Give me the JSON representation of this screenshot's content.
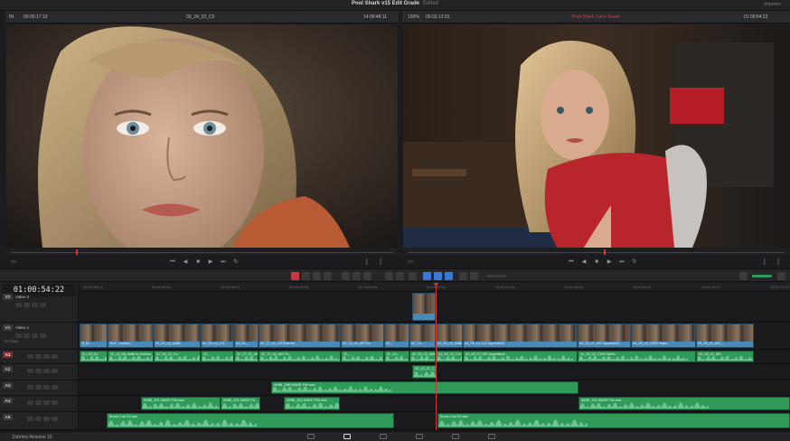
{
  "title_bar": {
    "project": "Pool Shark v15 Edit Grade",
    "status": "Edited",
    "right_label": "Importer"
  },
  "viewer_left": {
    "in_label": "IN",
    "source_tc": "00:00:17:13",
    "clip_name": "03_24_02_C0",
    "clip_tc": "14:09:48:11"
  },
  "viewer_right": {
    "zoom": "126%",
    "duration": "00:02:13:01",
    "timeline_name": "Pool Shark Color Grade",
    "record_tc": "01:00:54:22"
  },
  "scrub": {
    "left_position": 0.17,
    "right_position": 0.52
  },
  "timeline": {
    "timecode": "01:00:54:22",
    "ruler": [
      "01:00:35:13",
      "01:00:40:15",
      "01:00:45:14",
      "01:00:49:16",
      "01:00:53:16",
      "01:00:57:14",
      "01:01:01:16",
      "01:01:05:14",
      "01:01:09:11",
      "01:01:13:07",
      "01:01:17:15"
    ],
    "tracks": [
      {
        "tag": "V2",
        "name": "Video 2",
        "clips": ""
      },
      {
        "tag": "V1",
        "name": "Video 1",
        "clips": "16 Clips"
      },
      {
        "tag": "A1",
        "name": "",
        "clips": ""
      },
      {
        "tag": "A2",
        "name": "",
        "clips": ""
      },
      {
        "tag": "A3",
        "name": "",
        "clips": ""
      },
      {
        "tag": "A4",
        "name": "",
        "clips": ""
      },
      {
        "tag": "A5",
        "name": "",
        "clips": ""
      }
    ],
    "v1_clips": [
      "Ti_M..",
      "Text - Custom",
      "02_24_04_Walk..",
      "02_25_10_C4..",
      "02_24_..",
      "02_27_01_SS Exterior",
      "02_12_31_MS Fo..",
      "02_..",
      "02_14..",
      "02_26_10_Walk to Exterior",
      "04_09_10_CU Upperdeck",
      "04_22_07_MS Upperdeck",
      "04_08_02_CWS Stairs",
      "05_08_01_MS_.."
    ],
    "a1_clips": [
      "01_08_01..",
      "02_24_08_Walk to Exterior",
      "02_25_10_Cu..",
      "02_..",
      "02_27_01_MS Exterior",
      "02_12_31_MS Fo..",
      "02_..",
      "02_14..",
      "02_26_10_Walk to Exterior",
      "04_09_10_CU Upperdeck",
      "04_20_07_MS Upperdeck",
      "04_08_02_CWS Stairs",
      "05_08_01_MS.."
    ],
    "a2_clips": [
      "02_20_01_C.."
    ],
    "a3_clips": [
      "AMBI_2BR-WAVE File.wav"
    ],
    "a4_clips": [
      "AMBI_321-WAVE File.wav",
      "AMBI_321-WAVE Fil..",
      "AMBI_321-WAVE File.wav",
      "AMBI_115-WAVE File.wav"
    ],
    "a5_clips": [
      "Brush Cue 01.wav",
      "Brush Cue 02.wav"
    ]
  },
  "bottom_bar": {
    "app_name": "DaVinci Resolve 15"
  },
  "colors": {
    "video_clip": "#4a8ab8",
    "audio_clip": "#2f9a5a",
    "playhead": "#d23a3a",
    "background": "#1c1c1e"
  }
}
